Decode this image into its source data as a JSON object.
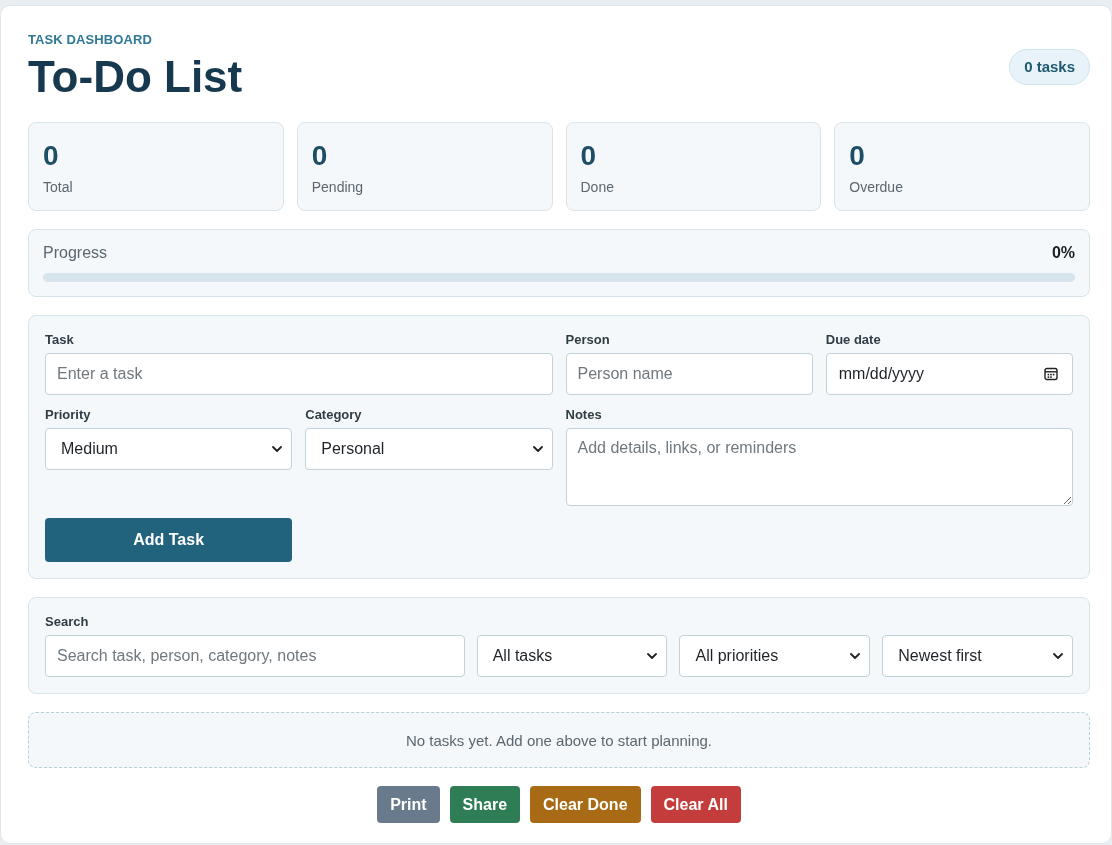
{
  "header": {
    "eyebrow": "TASK DASHBOARD",
    "title": "To-Do List",
    "count_badge": "0 tasks"
  },
  "stats": [
    {
      "value": "0",
      "label": "Total"
    },
    {
      "value": "0",
      "label": "Pending"
    },
    {
      "value": "0",
      "label": "Done"
    },
    {
      "value": "0",
      "label": "Overdue"
    }
  ],
  "progress": {
    "label": "Progress",
    "reading": "0%"
  },
  "task_form": {
    "fields": [
      {
        "kind": "text",
        "label": "Task",
        "placeholder": "Enter a task"
      },
      {
        "kind": "text",
        "label": "Person",
        "placeholder": "Person name"
      },
      {
        "kind": "date",
        "label": "Due date",
        "value": "mm/dd/yyyy"
      },
      {
        "kind": "select",
        "label": "Priority",
        "value": "Medium"
      },
      {
        "kind": "select",
        "label": "Category",
        "value": "Personal"
      },
      {
        "kind": "textarea",
        "label": "Notes",
        "placeholder": "Add details, links, or reminders"
      }
    ],
    "submit": "Add Task"
  },
  "filters": {
    "label": "Search",
    "search": {
      "placeholder": "Search task, person, category, notes"
    },
    "selects": [
      {
        "value": "All tasks"
      },
      {
        "value": "All priorities"
      },
      {
        "value": "Newest first"
      }
    ]
  },
  "empty_state": "No tasks yet. Add one above to start planning.",
  "actions": [
    {
      "kind": "neutral",
      "label": "Print"
    },
    {
      "kind": "success",
      "label": "Share"
    },
    {
      "kind": "warning",
      "label": "Clear Done"
    },
    {
      "kind": "danger",
      "label": "Clear All"
    }
  ]
}
